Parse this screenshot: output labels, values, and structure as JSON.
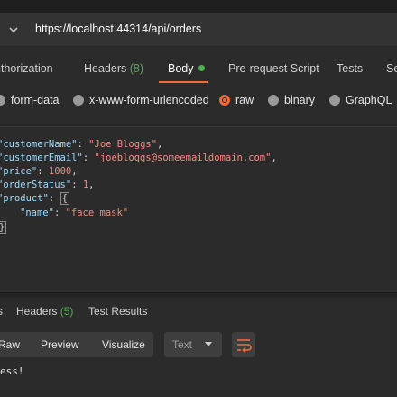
{
  "request": {
    "url": "https://localhost:44314/api/orders"
  },
  "request_tabs": {
    "authorization": "uthorization",
    "headers_label": "Headers",
    "headers_count": "(8)",
    "body": "Body",
    "prerequest": "Pre-request Script",
    "tests": "Tests",
    "settings": "Se"
  },
  "body_types": {
    "form_data": "form-data",
    "urlencoded": "x-www-form-urlencoded",
    "raw": "raw",
    "binary": "binary",
    "graphql": "GraphQL",
    "selected": "raw"
  },
  "editor": {
    "line1_key": "\"customerName\"",
    "line1_val": "\"Joe Bloggs\"",
    "line2_key": "\"customerEmail\"",
    "line2_val": "\"joebloggs@someemaildomain.com\"",
    "line3_key": "\"price\"",
    "line3_val": "1000",
    "line4_key": "\"orderStatus\"",
    "line4_val": "1",
    "line5_key": "\"product\"",
    "line5_brace": "{",
    "line6_key": "\"name\"",
    "line6_val": "\"face mask\"",
    "line7_brace": "}"
  },
  "response_tabs": {
    "body_fragment": "s",
    "headers_label": "Headers",
    "headers_count": "(5)",
    "test_results": "Test Results"
  },
  "response_toolbar": {
    "raw": "Raw",
    "preview": "Preview",
    "visualize": "Visualize",
    "format": "Text"
  },
  "response_body": "ess!",
  "colors": {
    "accent": "#f26b3a",
    "success": "#4caf50",
    "json_key": "#9cdcfe",
    "json_string": "#f28b82"
  }
}
